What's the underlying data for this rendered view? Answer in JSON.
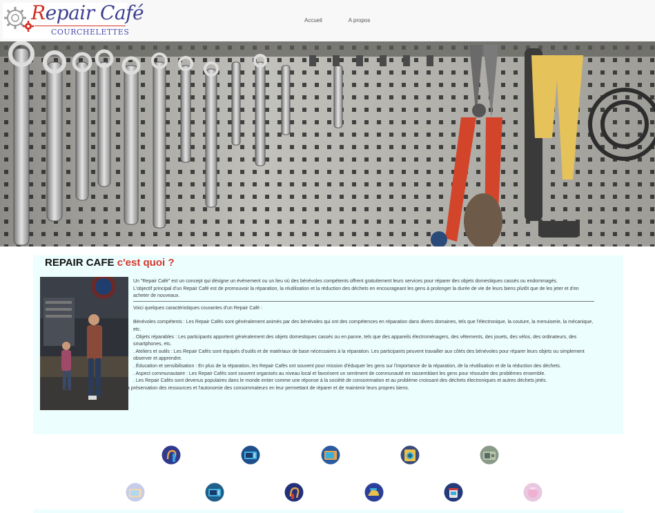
{
  "logo": {
    "title_first": "R",
    "title_rest": "epair Café",
    "subtitle": "COURCHELETTES"
  },
  "nav": {
    "items": [
      "Accueil",
      "A propos"
    ]
  },
  "colors": {
    "accent": "#d6362b",
    "brand": "#3d3f8f",
    "card_bg": "#edfefe"
  },
  "article": {
    "heading_main": "REPAIR CAFE",
    "heading_accent": "c'est quoi ?",
    "intro_1": "Un \"Repair Café\" est un concept qui désigne un événement ou un lieu où des bénévoles compétents offrent gratuitement leurs services pour réparer des objets domestiques cassés ou endommagés.",
    "intro_2": "L'objectif principal d'un Repair Café est de promouvoir la réparation, la réutilisation et la réduction des déchets en encourageant les gens à prolonger la durée de vie de leurs biens plutôt que de les jeter et d'en acheter de nouveaux.",
    "list_intro": "Voici quelques caractéristiques courantes d'un Repair Café :",
    "items": [
      "Bénévoles compétents : Les Repair Cafés sont généralement animés par des bénévoles qui ont des compétences en réparation dans divers domaines, tels que l'électronique, la couture, la menuiserie, la mécanique, etc.",
      ". Objets réparables : Les participants apportent généralement des objets domestiques cassés ou en panne, tels que des appareils électroménagers, des vêtements, des jouets, des vélos, des ordinateurs, des smartphones, etc.",
      ". Ateliers et outils : Les Repair Cafés sont équipés d'outils et de matériaux de base nécessaires à la réparation. Les participants peuvent travailler aux côtés des bénévoles pour réparer leurs objets ou simplement observer et apprendre.",
      ". Éducation et sensibilisation : En plus de la réparation, les Repair Cafés ont souvent pour mission d'éduquer les gens sur l'importance de la réparation, de la réutilisation et de la réduction des déchets.",
      ". Aspect communautaire : Les Repair Cafés sont souvent organisés au niveau local et favorisent un sentiment de communauté en rassemblant les gens pour résoudre des problèmes ensemble.",
      ". Les Repair Cafés sont devenus populaires dans le monde entier comme une réponse à la société de consommation et au problème croissant des déchets électroniques et autres déchets jetés."
    ],
    "closing": ". Ils encouragent la durabilité, la préservation des ressources et l'autonomie des consommateurs en leur permettant de réparer et de maintenir leurs propres biens."
  },
  "icons": [
    {
      "name": "hairdryer-icon",
      "color": "#2f3a8f"
    },
    {
      "name": "microwave-icon",
      "color": "#1f4f8a"
    },
    {
      "name": "television-icon",
      "color": "#2a5aa0"
    },
    {
      "name": "washing-machine-icon",
      "color": "#3a4a7a"
    },
    {
      "name": "radio-icon",
      "color": "#8a9a8a"
    },
    {
      "name": "tv-faded-icon",
      "color": "#c7cce8"
    },
    {
      "name": "microwave-icon-2",
      "color": "#1f5f8a"
    },
    {
      "name": "hairdryer-icon-2",
      "color": "#23307a"
    },
    {
      "name": "iron-icon",
      "color": "#2a3f9a"
    },
    {
      "name": "pressure-cooker-icon",
      "color": "#253a7a"
    },
    {
      "name": "kettle-faded-icon",
      "color": "#e8c8e0"
    }
  ]
}
